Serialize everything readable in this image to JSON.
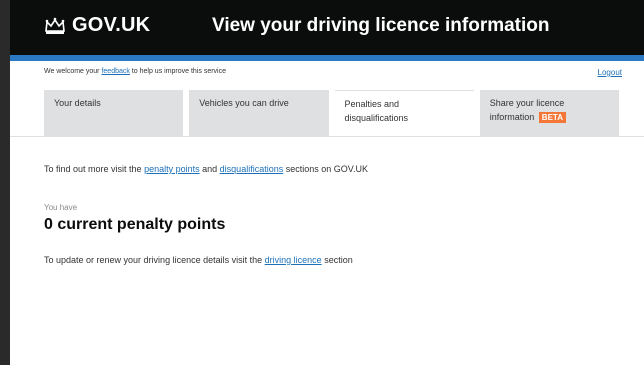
{
  "header": {
    "logo_text": "GOV.UK",
    "service_title": "View your driving licence information"
  },
  "banner": {
    "feedback_pre": "We welcome your",
    "feedback_link": "feedback",
    "feedback_post": "to help us improve this service",
    "logout": "Logout"
  },
  "tabs": [
    {
      "label": "Your details"
    },
    {
      "label": "Vehicles you can drive"
    },
    {
      "label": "Penalties and disqualifications"
    },
    {
      "label": "Share your licence information",
      "badge": "BETA"
    }
  ],
  "main": {
    "info_pre": "To find out more visit the",
    "penalty_link": "penalty points",
    "and": "and",
    "disq_link": "disqualifications",
    "info_post": "sections on GOV.UK",
    "you_have": "You have",
    "points": "0 current penalty points",
    "update_pre": "To update or renew your driving licence details visit the",
    "update_link": "driving licence",
    "update_post": "section"
  },
  "colors": {
    "header": "#0b0c0c",
    "accent": "#2b78c5",
    "beta": "#f47738",
    "link": "#1d70b8"
  }
}
